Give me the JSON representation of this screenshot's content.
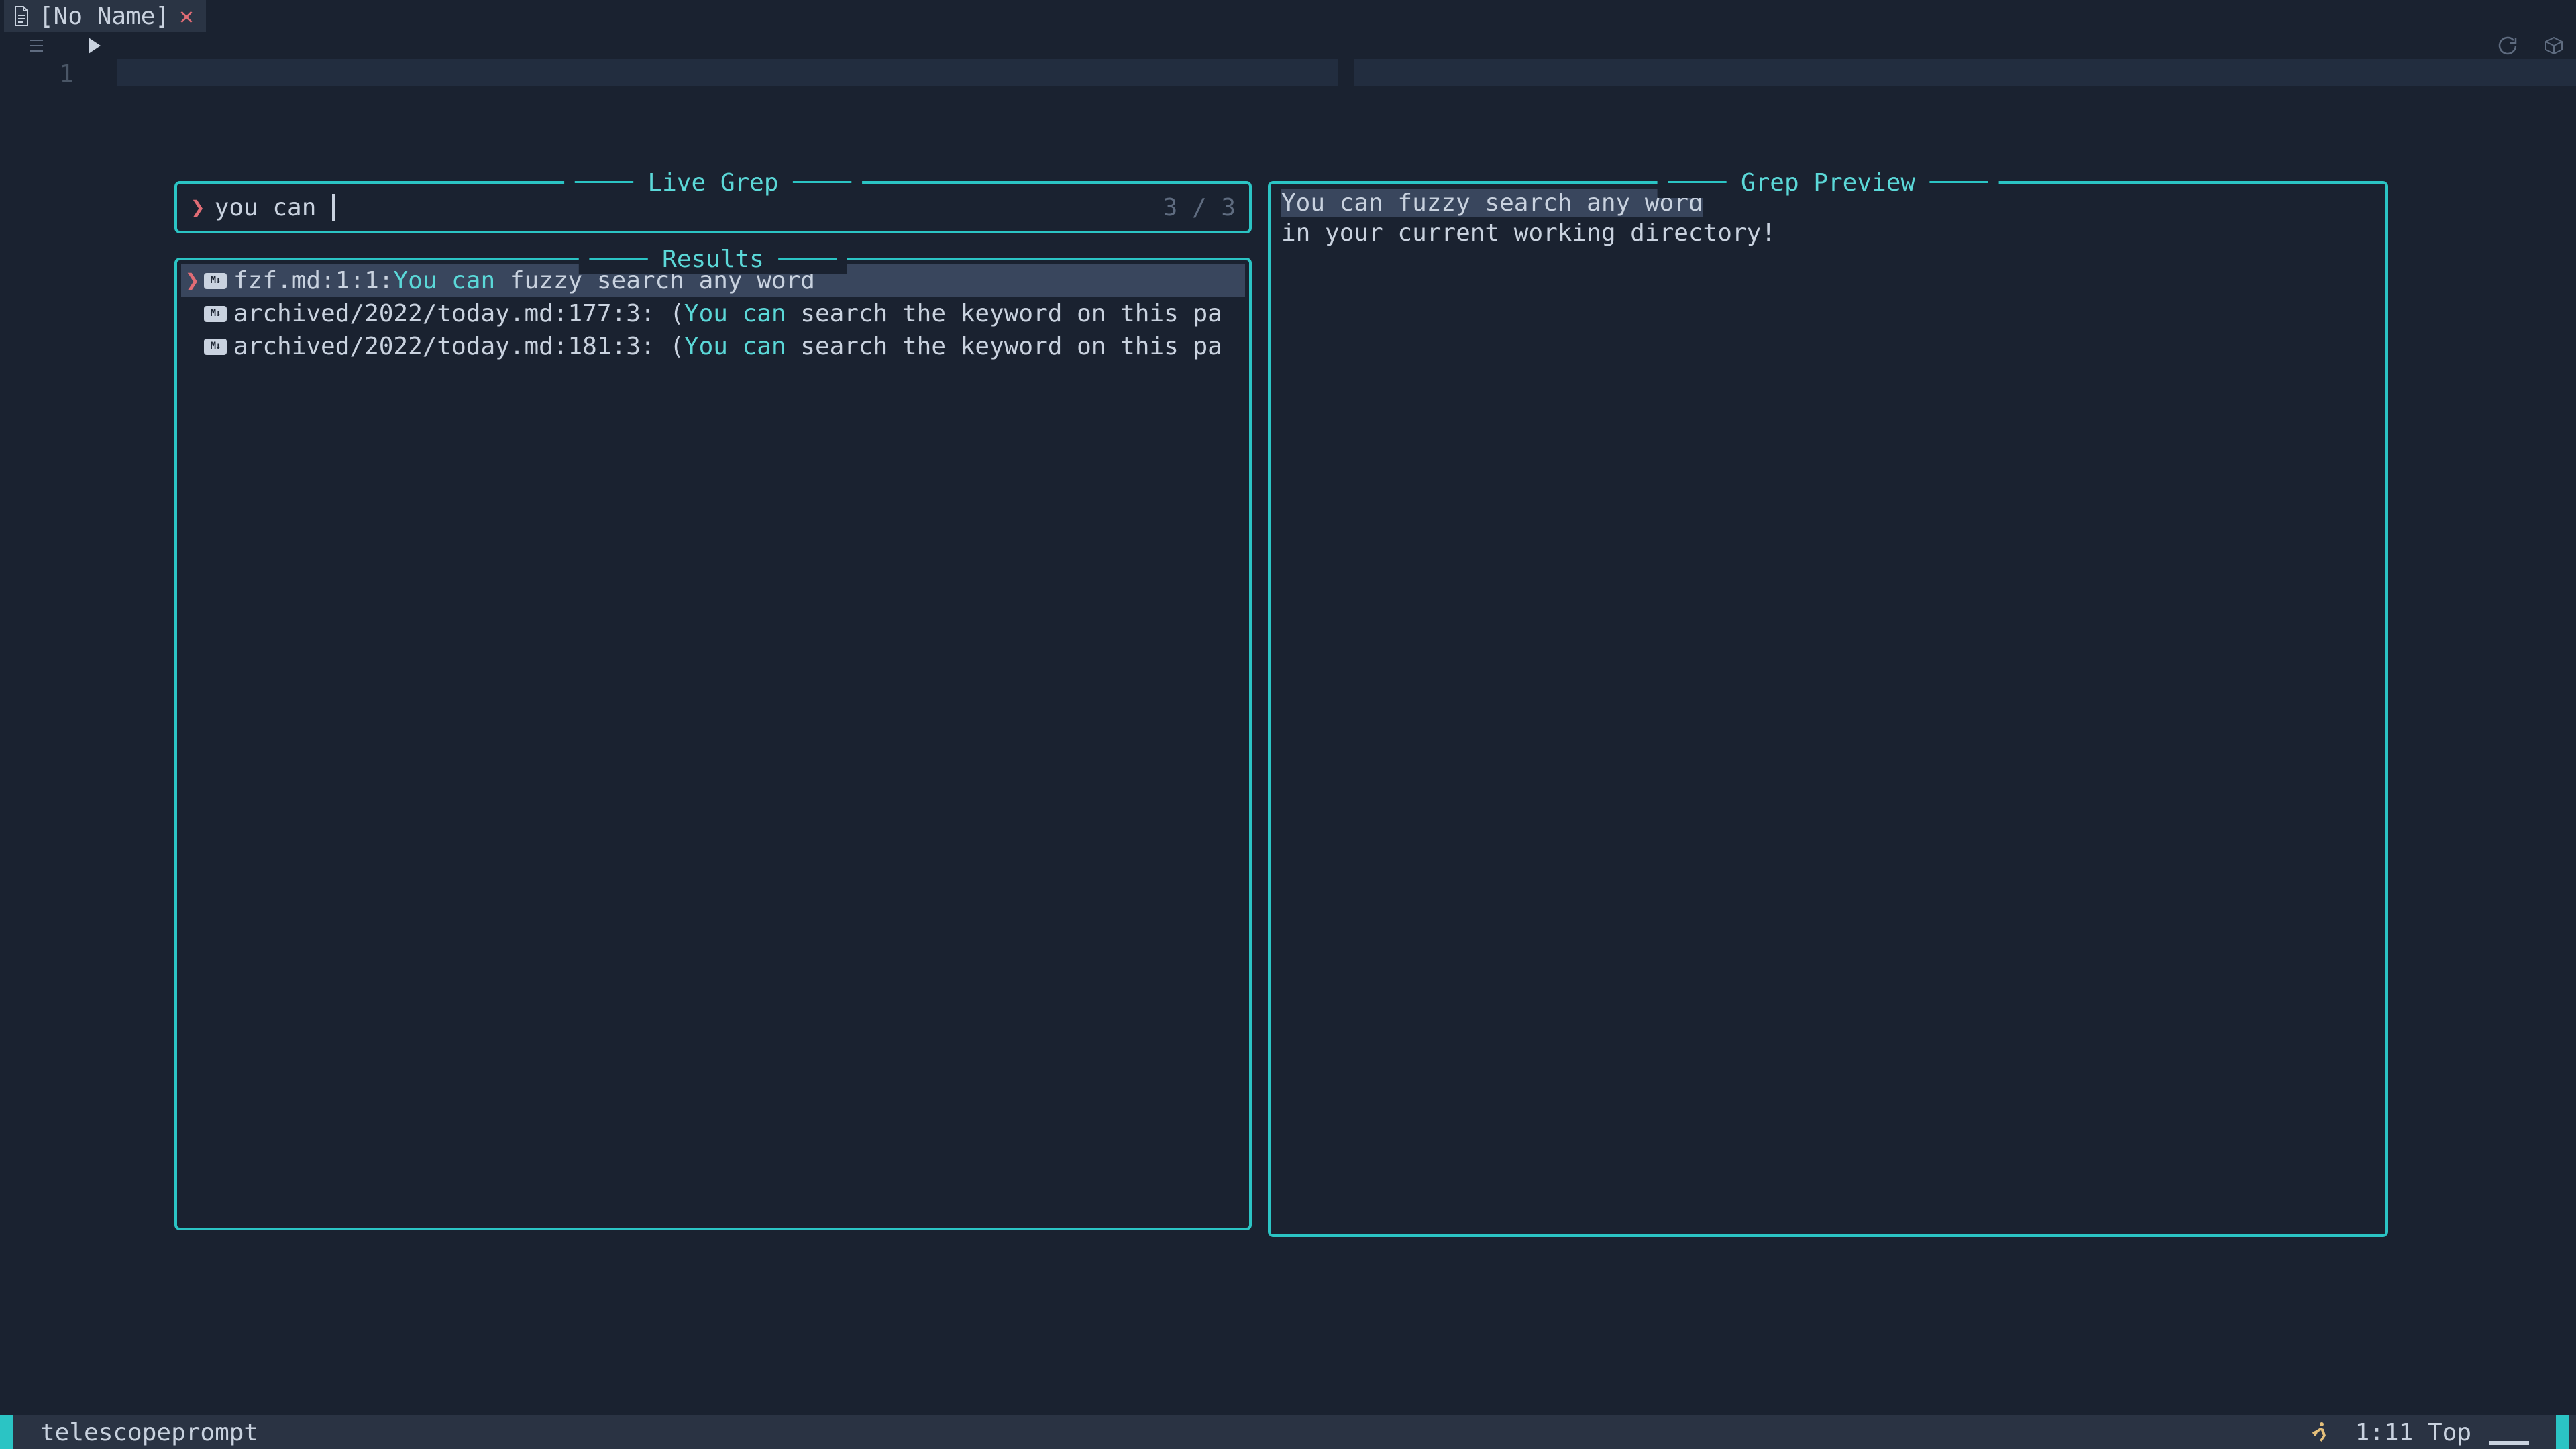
{
  "tab": {
    "title": "[No Name]"
  },
  "gutter": {
    "line_number": "1"
  },
  "telescope": {
    "prompt_title": "Live Grep",
    "results_title": "Results",
    "preview_title": "Grep Preview",
    "prompt_caret": "❯",
    "query": "you can ",
    "count": "3 / 3",
    "results": [
      {
        "selected": true,
        "path": "fzf.md:1:1:",
        "match": "You can",
        "rest": " fuzzy search any word"
      },
      {
        "selected": false,
        "path": "archived/2022/today.md:177:3: (",
        "match": "You can",
        "rest": " search the keyword on this pa"
      },
      {
        "selected": false,
        "path": "archived/2022/today.md:181:3: (",
        "match": "You can",
        "rest": " search the keyword on this pa"
      }
    ],
    "preview": {
      "highlighted_line": "You can fuzzy search any word",
      "lines": [
        "in your current working directory!"
      ]
    }
  },
  "statusline": {
    "mode": "telescopeprompt",
    "position": "1:11",
    "scroll": "Top"
  },
  "icons": {
    "doc": "document-icon",
    "close": "close-icon",
    "outline": "outline-icon",
    "play": "play-icon",
    "refresh": "refresh-icon",
    "package": "package-icon",
    "runner": "runner-icon",
    "markdown": "M↓"
  }
}
